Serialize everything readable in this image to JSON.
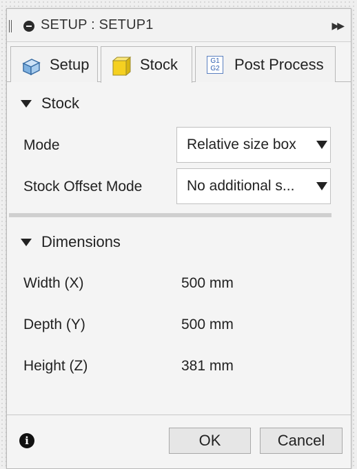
{
  "titlebar": {
    "title": "SETUP : SETUP1"
  },
  "tabs": [
    {
      "label": "Setup",
      "icon": "blue-box-icon"
    },
    {
      "label": "Stock",
      "icon": "yellow-box-icon",
      "active": true
    },
    {
      "label": "Post Process",
      "icon": "gcode-icon",
      "icon_text": [
        "G1",
        "G2"
      ]
    }
  ],
  "stock": {
    "header": "Stock",
    "mode_label": "Mode",
    "mode_value": "Relative size box",
    "offset_label": "Stock Offset Mode",
    "offset_value": "No additional s..."
  },
  "dimensions": {
    "header": "Dimensions",
    "rows": [
      {
        "label": "Width (X)",
        "value": "500 mm"
      },
      {
        "label": "Depth (Y)",
        "value": "500 mm"
      },
      {
        "label": "Height (Z)",
        "value": "381 mm"
      }
    ]
  },
  "footer": {
    "info_glyph": "i",
    "ok_label": "OK",
    "cancel_label": "Cancel"
  },
  "colors": {
    "active_tab_icon": "#f5d020",
    "setup_tab_icon": "#6fa8dc",
    "gcode_icon": "#2f5fb0"
  }
}
